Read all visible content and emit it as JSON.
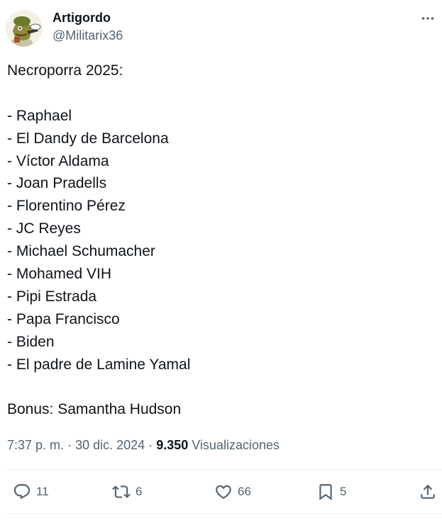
{
  "tweet": {
    "author": {
      "display_name": "Artigordo",
      "handle": "@Militarix36"
    },
    "body_lines": [
      "Necroporra 2025:",
      "",
      "- Raphael",
      "- El Dandy de Barcelona",
      "- Víctor Aldama",
      "- Joan Pradells",
      "- Florentino Pérez",
      "- JC Reyes",
      "- Michael Schumacher",
      "- Mohamed VIH",
      "- Pipi Estrada",
      "- Papa Francisco",
      "- Biden",
      "- El padre de Lamine Yamal",
      "",
      "Bonus: Samantha Hudson"
    ],
    "time": "7:37 p. m.",
    "separator": "·",
    "date": "30 dic. 2024",
    "views_count": "9.350",
    "views_label": "Visualizaciones"
  },
  "actions": {
    "replies": "11",
    "reposts": "6",
    "likes": "66",
    "bookmarks": "5"
  },
  "icons": {
    "more": "more-icon",
    "reply": "reply-icon",
    "repost": "repost-icon",
    "like": "heart-icon",
    "bookmark": "bookmark-icon",
    "share": "share-icon"
  },
  "colors": {
    "text": "#0f1419",
    "secondary": "#536471",
    "divider": "#eff3f4"
  }
}
